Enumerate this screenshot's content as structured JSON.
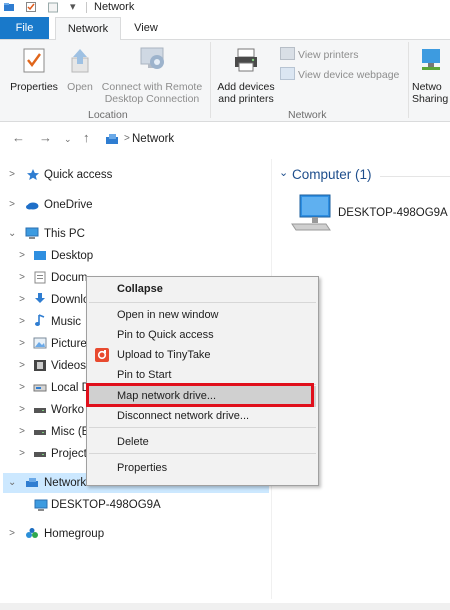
{
  "window": {
    "title": "Network"
  },
  "ribbon": {
    "tabs": {
      "file": "File",
      "network": "Network",
      "view": "View"
    },
    "location": {
      "label": "Location",
      "properties": "Properties",
      "open": "Open",
      "connect_remote_line1": "Connect with Remote",
      "connect_remote_line2": "Desktop Connection"
    },
    "network": {
      "label": "Network",
      "add_devices_line1": "Add devices",
      "add_devices_line2": "and printers",
      "view_printers": "View printers",
      "view_device_webpage": "View device webpage",
      "sharing_line1": "Netwo",
      "sharing_line2": "Sharing"
    }
  },
  "address": {
    "crumb": "Network",
    "separator": ">"
  },
  "nav": {
    "quick_access": "Quick access",
    "onedrive": "OneDrive",
    "this_pc": "This PC",
    "desktop": "Desktop",
    "documents": "Docum",
    "downloads": "Downlo",
    "music": "Music",
    "pictures": "Picture",
    "videos": "Videos",
    "local_disk": "Local D",
    "work": "Worko",
    "misc": "Misc (E",
    "projects": "Project",
    "network": "Network",
    "desktop_host": "DESKTOP-498OG9A",
    "homegroup": "Homegroup"
  },
  "content": {
    "group_header": "Computer (1)",
    "computer_name": "DESKTOP-498OG9A"
  },
  "context_menu": {
    "collapse": "Collapse",
    "open_new_window": "Open in new window",
    "pin_quick_access": "Pin to Quick access",
    "upload_tinytake": "Upload to TinyTake",
    "pin_start": "Pin to Start",
    "map_drive": "Map network drive...",
    "disconnect_drive": "Disconnect network drive...",
    "delete": "Delete",
    "properties": "Properties"
  },
  "colors": {
    "accent": "#1979ca",
    "highlight_box": "#e00f1b",
    "selection": "#cce8ff"
  }
}
